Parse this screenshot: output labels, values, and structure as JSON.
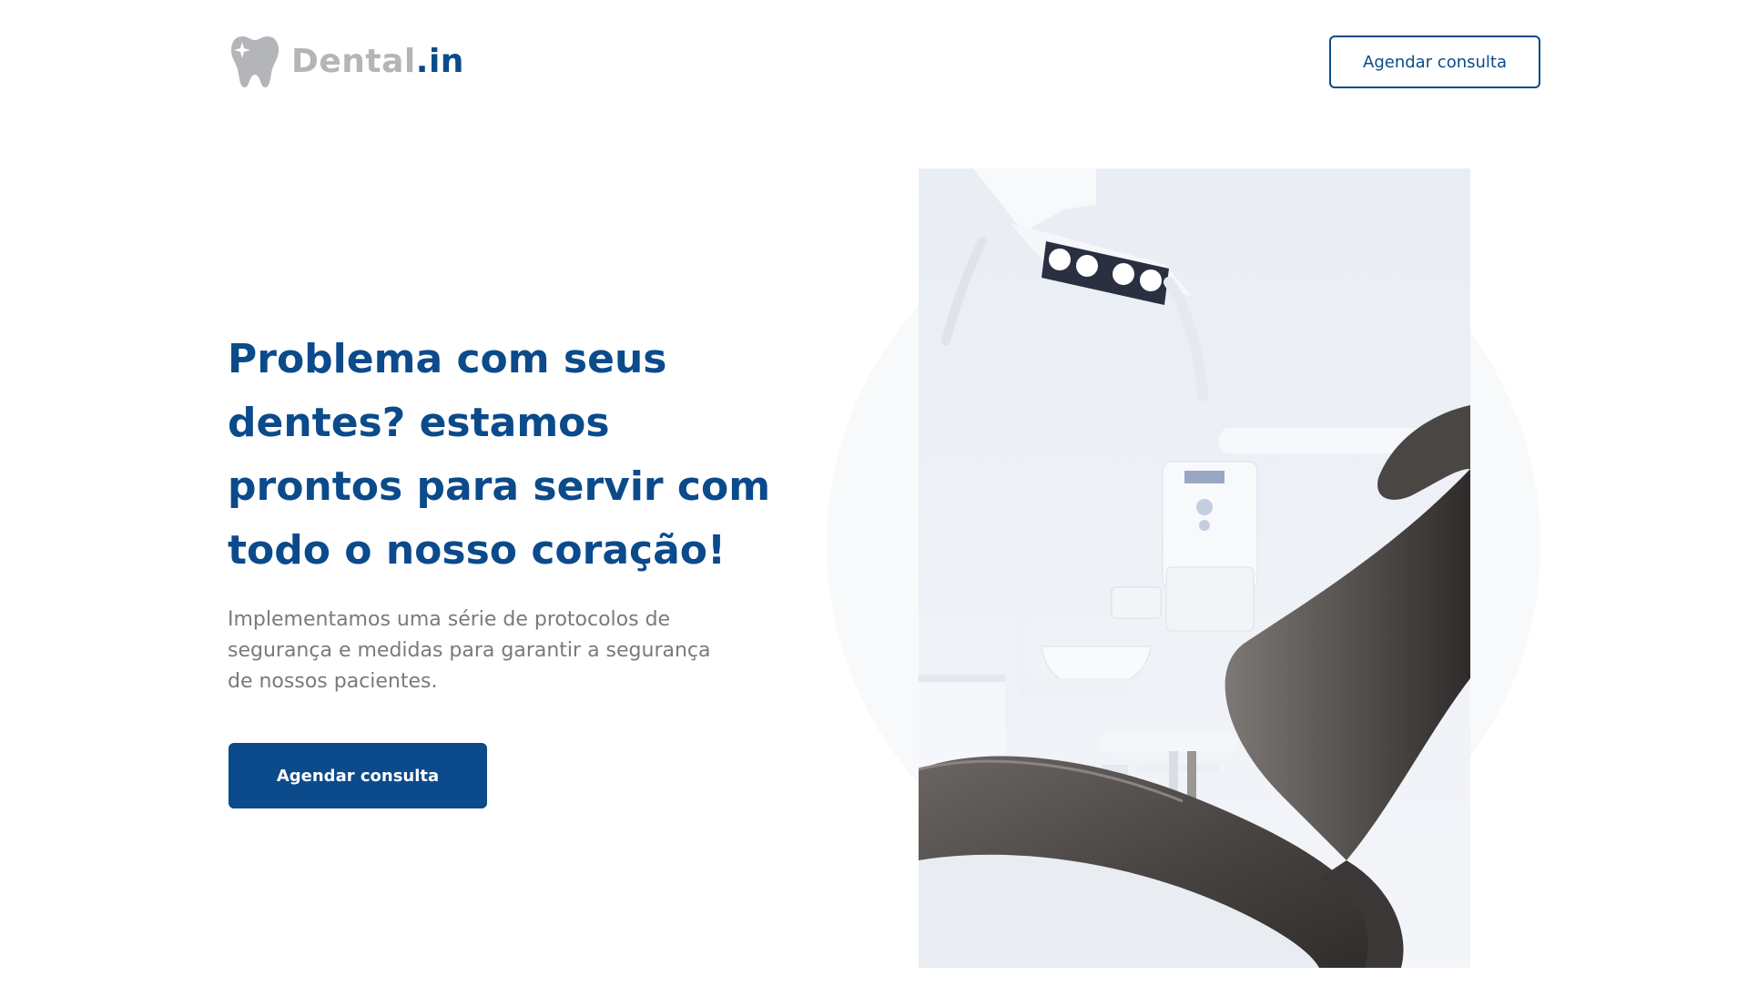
{
  "header": {
    "logo": {
      "icon": "tooth-sparkle-icon",
      "text_main": "Dental",
      "text_accent": ".in",
      "colors": {
        "main": "#b3b5b8",
        "accent": "#0b4a8b"
      }
    },
    "cta_label": "Agendar consulta"
  },
  "hero": {
    "title_lines": [
      "Problema com seus",
      "dentes? estamos",
      "prontos para servir com",
      "todo o nosso coração!"
    ],
    "subtitle_lines": [
      "Implementamos uma série de protocolos de",
      "segurança e medidas para garantir a segurança",
      "de nossos pacientes."
    ],
    "cta_label": "Agendar consulta",
    "image": "dental-chair-photo"
  },
  "colors": {
    "primary": "#0b4a8b",
    "text_muted": "#7a7a7a",
    "background": "#ffffff",
    "circle": "#f8f9fa"
  }
}
